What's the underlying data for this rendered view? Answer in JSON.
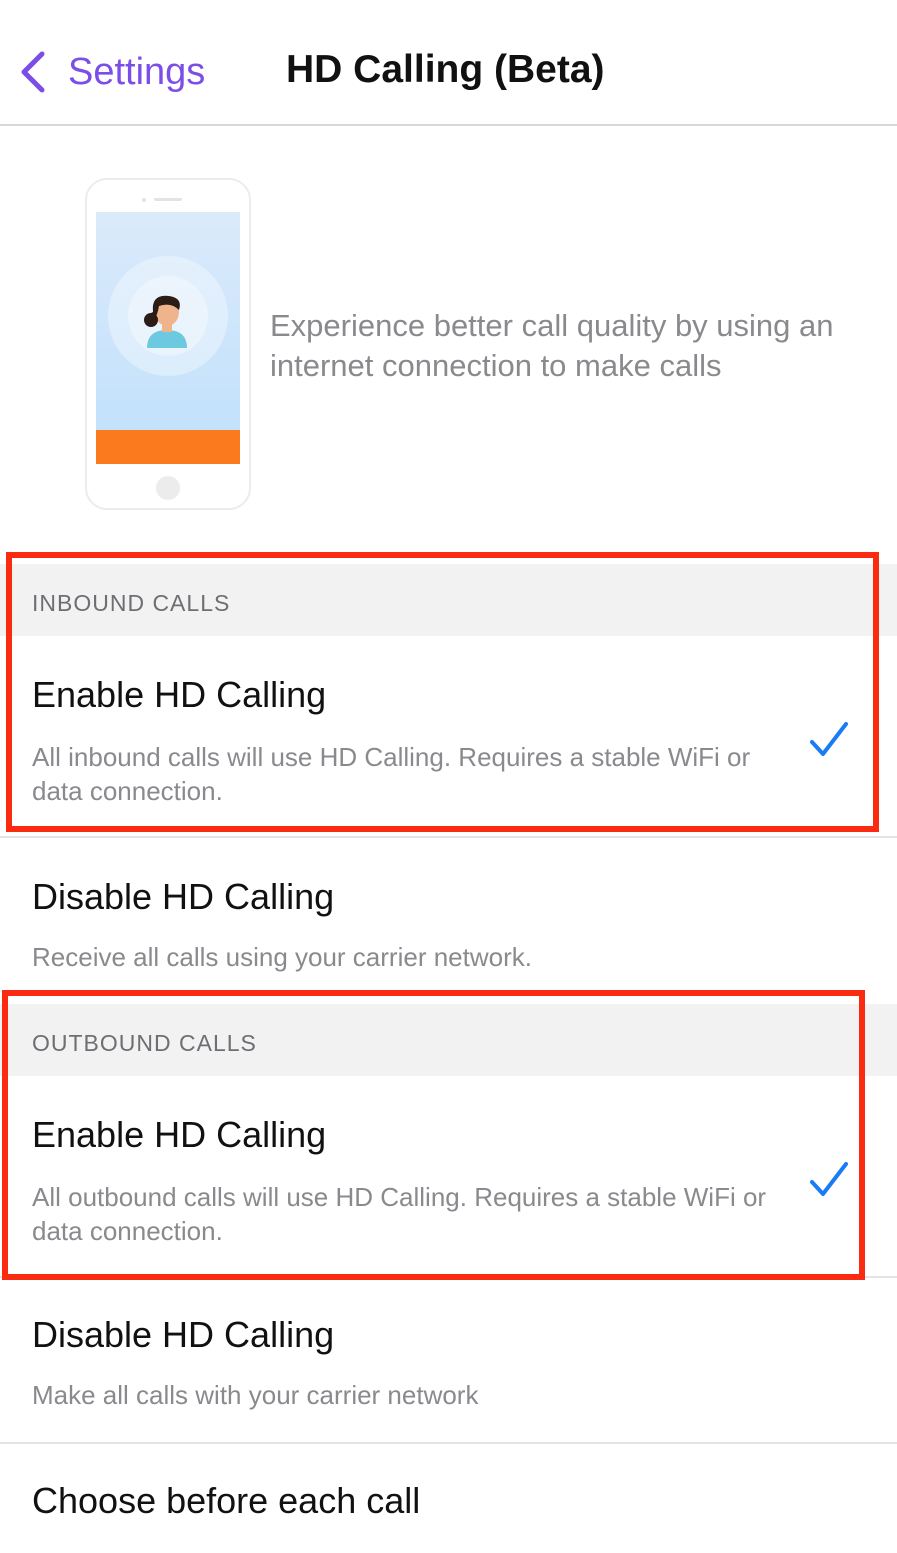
{
  "nav": {
    "back_label": "Settings",
    "title": "HD Calling (Beta)"
  },
  "hero": {
    "description": "Experience better call quality by using an internet connection to make calls"
  },
  "inbound": {
    "header": "INBOUND CALLS",
    "options": [
      {
        "title": "Enable HD Calling",
        "subtitle": "All inbound calls will use HD Calling. Requires a stable WiFi or data connection.",
        "selected": true
      },
      {
        "title": "Disable HD Calling",
        "subtitle": "Receive all calls using your carrier network.",
        "selected": false
      }
    ]
  },
  "outbound": {
    "header": "OUTBOUND CALLS",
    "options": [
      {
        "title": "Enable HD Calling",
        "subtitle": "All outbound calls will use HD Calling. Requires a stable WiFi or data connection.",
        "selected": true
      },
      {
        "title": "Disable HD Calling",
        "subtitle": "Make all calls with your carrier network",
        "selected": false
      },
      {
        "title": "Choose before each call",
        "subtitle": "",
        "selected": false
      }
    ]
  },
  "colors": {
    "accent": "#7b4ee8",
    "check": "#1a7cf5",
    "highlight": "#fb2b12",
    "phone_bar": "#fb7a1e"
  }
}
